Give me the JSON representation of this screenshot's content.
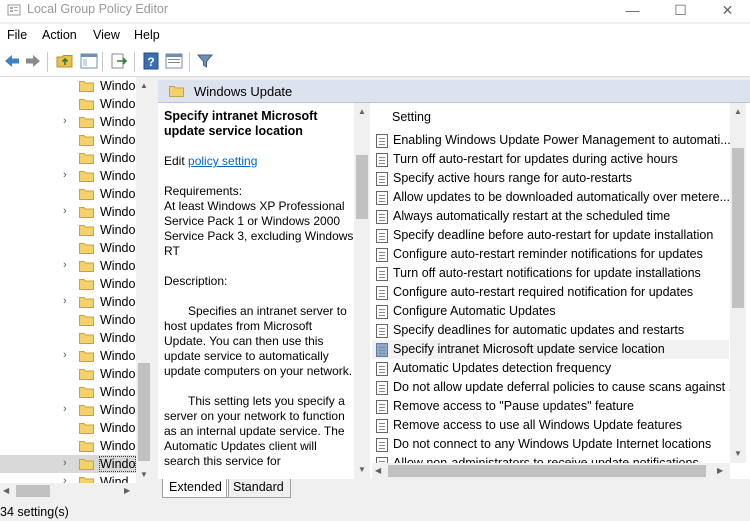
{
  "window": {
    "title": "Local Group Policy Editor",
    "minimize": "—",
    "maximize": "☐",
    "close": "✕"
  },
  "menu": [
    "File",
    "Action",
    "View",
    "Help"
  ],
  "toolbar": {
    "buttons": [
      "back-icon",
      "forward-icon",
      "up-folder-icon",
      "show-hide-tree-icon",
      "export-list-icon",
      "help-icon",
      "properties-icon",
      "filter-icon"
    ]
  },
  "tree": {
    "items": [
      {
        "label": "Windo",
        "expandable": false
      },
      {
        "label": "Windo",
        "expandable": false
      },
      {
        "label": "Windo",
        "expandable": true
      },
      {
        "label": "Windo",
        "expandable": false
      },
      {
        "label": "Windo",
        "expandable": false
      },
      {
        "label": "Windo",
        "expandable": true
      },
      {
        "label": "Windo",
        "expandable": false
      },
      {
        "label": "Windo",
        "expandable": true
      },
      {
        "label": "Windo",
        "expandable": false
      },
      {
        "label": "Windo",
        "expandable": false
      },
      {
        "label": "Windo",
        "expandable": true
      },
      {
        "label": "Windo",
        "expandable": false
      },
      {
        "label": "Windo",
        "expandable": true
      },
      {
        "label": "Windo",
        "expandable": false
      },
      {
        "label": "Windo",
        "expandable": false
      },
      {
        "label": "Windo",
        "expandable": true
      },
      {
        "label": "Windo",
        "expandable": false
      },
      {
        "label": "Windo",
        "expandable": false
      },
      {
        "label": "Windo",
        "expandable": true
      },
      {
        "label": "Windo",
        "expandable": false
      },
      {
        "label": "Windo",
        "expandable": false
      },
      {
        "label": "Windo",
        "expandable": true,
        "selected": true
      },
      {
        "label": "Wind",
        "expandable": true
      }
    ]
  },
  "pane": {
    "header": "Windows Update",
    "extended": {
      "title": "Specify intranet Microsoft update service location",
      "edit_prefix": "Edit",
      "edit_link": "policy setting",
      "requirements_label": "Requirements:",
      "requirements": "At least Windows XP Professional Service Pack 1 or Windows 2000 Service Pack 3, excluding Windows RT",
      "description_label": "Description:",
      "desc1": "Specifies an intranet server to host updates from Microsoft Update. You can then use this update service to automatically update computers on your network.",
      "desc2": "This setting lets you specify a server on your network to function as an internal update service. The Automatic Updates client will search this service for"
    },
    "list": {
      "column": "Setting",
      "rows": [
        "Enabling Windows Update Power Management to automati...",
        "Turn off auto-restart for updates during active hours",
        "Specify active hours range for auto-restarts",
        "Allow updates to be downloaded automatically over metere...",
        "Always automatically restart at the scheduled time",
        "Specify deadline before auto-restart for update installation",
        "Configure auto-restart reminder notifications for updates",
        "Turn off auto-restart notifications for update installations",
        "Configure auto-restart required notification for updates",
        "Configure Automatic Updates",
        "Specify deadlines for automatic updates and restarts",
        "Specify intranet Microsoft update service location",
        "Automatic Updates detection frequency",
        "Do not allow update deferral policies to cause scans against ...",
        "Remove access to \"Pause updates\" feature",
        "Remove access to use all Windows Update features",
        "Do not connect to any Windows Update Internet locations",
        "Allow non-administrators to receive update notifications"
      ],
      "selected_index": 11
    },
    "tabs": [
      "Extended",
      "Standard"
    ],
    "active_tab": "Extended"
  },
  "status": "34 setting(s)"
}
